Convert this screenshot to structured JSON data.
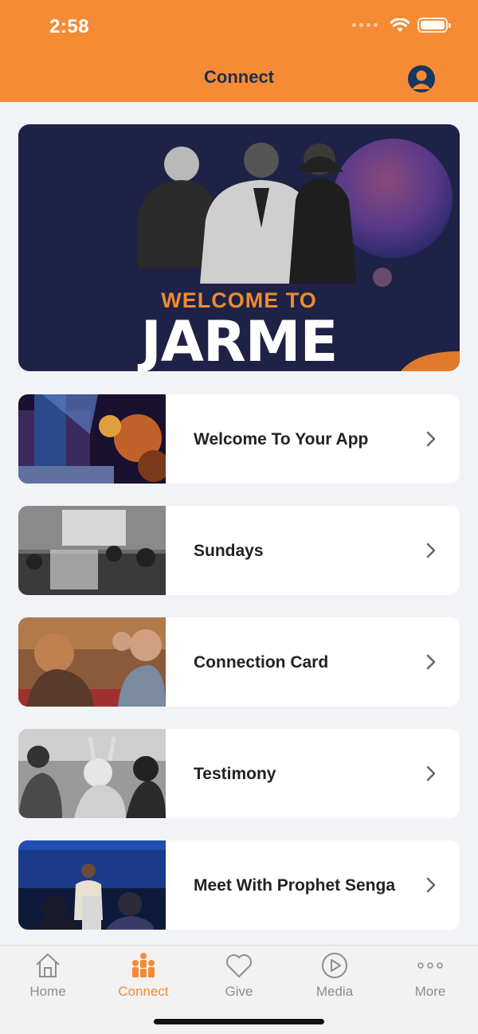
{
  "status_bar": {
    "time": "2:58"
  },
  "nav": {
    "title": "Connect",
    "profile_icon": "person-circle-icon"
  },
  "hero": {
    "subtitle": "WELCOME TO",
    "title": "JARME"
  },
  "cards": [
    {
      "label": "Welcome To Your App",
      "thumb": "concert-stage"
    },
    {
      "label": "Sundays",
      "thumb": "congregation-bw"
    },
    {
      "label": "Connection Card",
      "thumb": "conversation"
    },
    {
      "label": "Testimony",
      "thumb": "worship-bw"
    },
    {
      "label": "Meet With Prophet Senga",
      "thumb": "preacher-stage"
    }
  ],
  "tabs": [
    {
      "label": "Home",
      "icon": "home-icon",
      "active": false
    },
    {
      "label": "Connect",
      "icon": "people-icon",
      "active": true
    },
    {
      "label": "Give",
      "icon": "heart-icon",
      "active": false
    },
    {
      "label": "Media",
      "icon": "play-circle-icon",
      "active": false
    },
    {
      "label": "More",
      "icon": "more-dots-icon",
      "active": false
    }
  ],
  "colors": {
    "accent": "#f68b35",
    "nav_title": "#1f2d4a",
    "hero_bg": "#1f2247",
    "inactive": "#8e8e93"
  }
}
